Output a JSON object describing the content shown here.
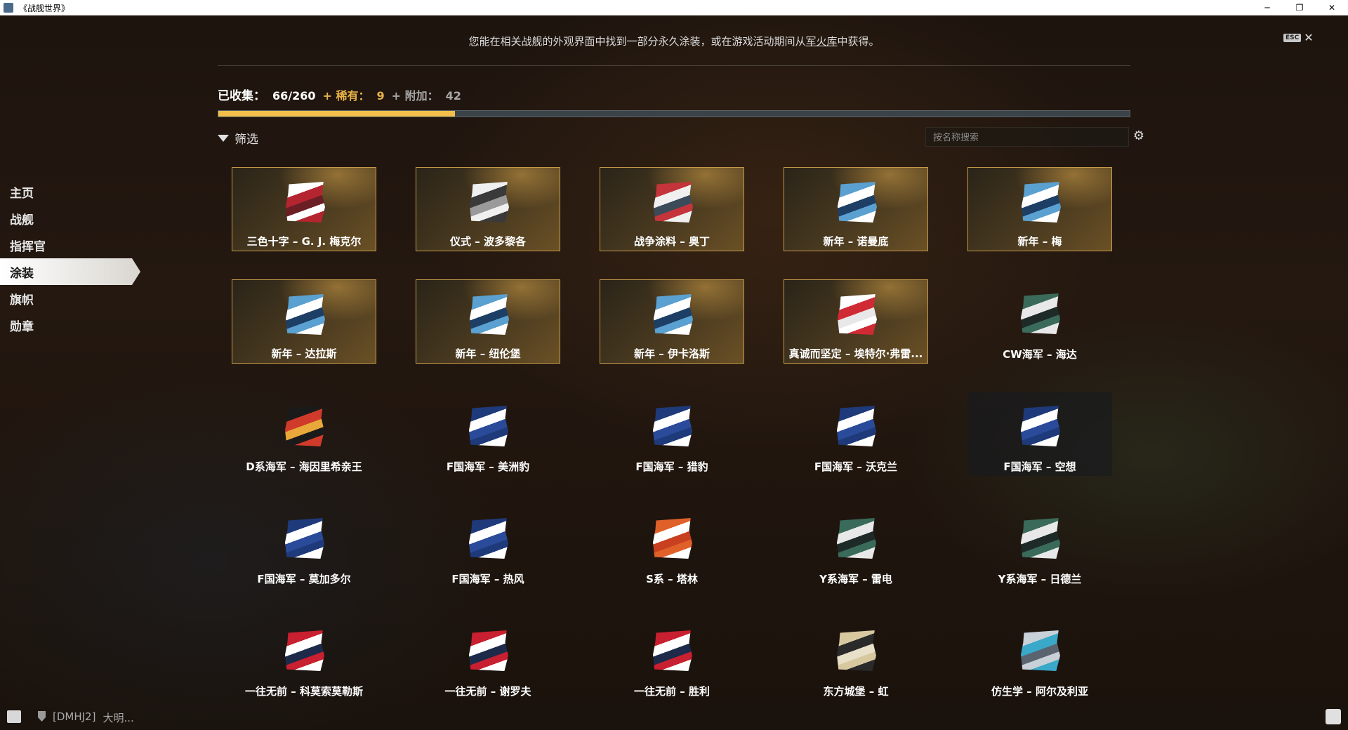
{
  "window": {
    "title": "《战舰世界》",
    "controls": [
      "─",
      "❐",
      "✕"
    ]
  },
  "notice": {
    "text_before": "您能在相关战舰的外观界面中找到一部分永久涂装，或在游戏活动期间从",
    "link": "军火库",
    "text_after": "中获得。"
  },
  "esc": {
    "key": "ESC",
    "close": "✕"
  },
  "collection": {
    "label": "已收集：",
    "count": "66/260",
    "rare_label": "+ 稀有：",
    "rare_count": "9",
    "extra_label": "+ 附加：",
    "extra_count": "42",
    "progress": 0.26
  },
  "filter": {
    "label": "筛选"
  },
  "search": {
    "placeholder": "按名称搜索"
  },
  "sidebar": {
    "items": [
      {
        "label": "主页"
      },
      {
        "label": "战舰"
      },
      {
        "label": "指挥官"
      },
      {
        "label": "涂装"
      },
      {
        "label": "旗帜"
      },
      {
        "label": "勋章"
      }
    ],
    "active_index": 3
  },
  "camos": [
    {
      "name": "三色十字 – G. J. 梅克尔",
      "rare": true,
      "colors": [
        "#ffffff",
        "#b4252f",
        "#6b1e24"
      ]
    },
    {
      "name": "仪式 – 波多黎各",
      "rare": true,
      "colors": [
        "#f0f0f0",
        "#3a3a3a",
        "#9a9a9a"
      ]
    },
    {
      "name": "战争涂料 – 奥丁",
      "rare": true,
      "colors": [
        "#c4343a",
        "#f0f0f0",
        "#3b4b5a"
      ]
    },
    {
      "name": "新年 – 诺曼底",
      "rare": true,
      "colors": [
        "#5aa0d0",
        "#ffffff",
        "#1d3f66"
      ]
    },
    {
      "name": "新年 – 梅",
      "rare": true,
      "colors": [
        "#5aa0d0",
        "#ffffff",
        "#1d3f66"
      ]
    },
    {
      "name": "新年 – 达拉斯",
      "rare": true,
      "colors": [
        "#5aa0d0",
        "#ffffff",
        "#1d3f66"
      ]
    },
    {
      "name": "新年 – 纽伦堡",
      "rare": true,
      "colors": [
        "#5aa0d0",
        "#ffffff",
        "#1d3f66"
      ]
    },
    {
      "name": "新年 – 伊卡洛斯",
      "rare": true,
      "colors": [
        "#5aa0d0",
        "#ffffff",
        "#1d3f66"
      ]
    },
    {
      "name": "真诚而坚定 – 埃特尔·弗雷...",
      "rare": true,
      "colors": [
        "#ffffff",
        "#d02a35",
        "#e8e8e8"
      ]
    },
    {
      "name": "CW海军 – 海达",
      "rare": false,
      "colors": [
        "#3a6a5a",
        "#e8e8e8",
        "#1e2a28"
      ]
    },
    {
      "name": "D系海军 – 海因里希亲王",
      "rare": false,
      "colors": [
        "#1a1a1a",
        "#d03a2a",
        "#e8a83a"
      ]
    },
    {
      "name": "F国海军 – 美洲豹",
      "rare": false,
      "colors": [
        "#1e3a7a",
        "#ffffff",
        "#2a4a9a"
      ]
    },
    {
      "name": "F国海军 – 猎豹",
      "rare": false,
      "colors": [
        "#1e3a7a",
        "#ffffff",
        "#2a4a9a"
      ]
    },
    {
      "name": "F国海军 – 沃克兰",
      "rare": false,
      "colors": [
        "#1e3a7a",
        "#ffffff",
        "#2a4a9a"
      ]
    },
    {
      "name": "F国海军 – 空想",
      "rare": false,
      "dim": true,
      "colors": [
        "#1e3a7a",
        "#ffffff",
        "#2a4a9a"
      ]
    },
    {
      "name": "F国海军 – 莫加多尔",
      "rare": false,
      "colors": [
        "#1e3a7a",
        "#ffffff",
        "#2a4a9a"
      ]
    },
    {
      "name": "F国海军 – 热风",
      "rare": false,
      "colors": [
        "#1e3a7a",
        "#ffffff",
        "#2a4a9a"
      ]
    },
    {
      "name": "S系 – 塔林",
      "rare": false,
      "colors": [
        "#e0602a",
        "#ffffff",
        "#c84020"
      ]
    },
    {
      "name": "Y系海军 – 雷电",
      "rare": false,
      "colors": [
        "#3a6a5a",
        "#e8e8e8",
        "#1e2a28"
      ]
    },
    {
      "name": "Y系海军 – 日德兰",
      "rare": false,
      "colors": [
        "#3a6a5a",
        "#e8e8e8",
        "#1e2a28"
      ]
    },
    {
      "name": "一往无前 – 科莫索莫勒斯",
      "rare": false,
      "colors": [
        "#c82030",
        "#ffffff",
        "#1e2a4a"
      ]
    },
    {
      "name": "一往无前 – 谢罗夫",
      "rare": false,
      "colors": [
        "#c82030",
        "#ffffff",
        "#1e2a4a"
      ]
    },
    {
      "name": "一往无前 – 胜利",
      "rare": false,
      "colors": [
        "#c82030",
        "#ffffff",
        "#1e2a4a"
      ]
    },
    {
      "name": "东方城堡 – 虹",
      "rare": false,
      "colors": [
        "#d8c8a0",
        "#2a2a2a",
        "#e8e0c8"
      ]
    },
    {
      "name": "仿生学 – 阿尔及利亚",
      "rare": false,
      "colors": [
        "#c8d0d8",
        "#3aa8c8",
        "#5a6470"
      ]
    }
  ],
  "footer": {
    "clan_tag": "[DMHJ2]",
    "clan_name": "大明..."
  }
}
